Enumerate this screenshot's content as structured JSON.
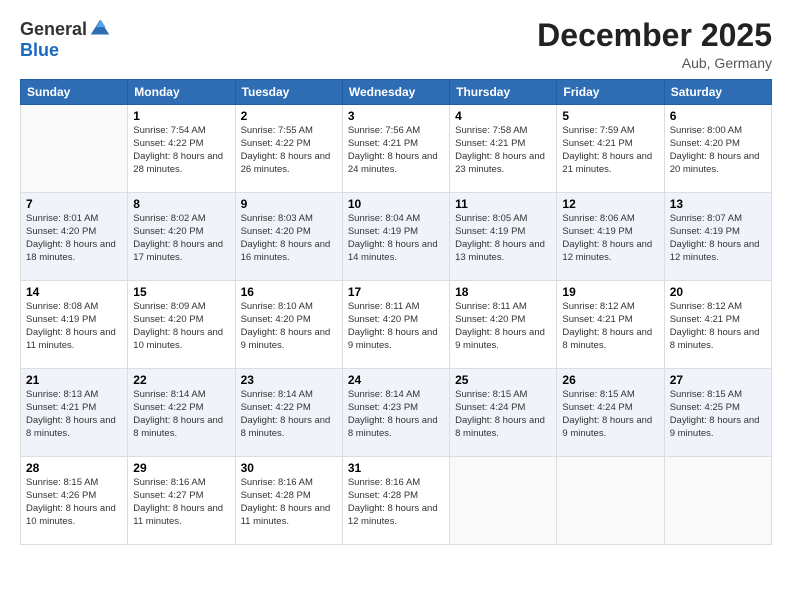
{
  "logo": {
    "general": "General",
    "blue": "Blue"
  },
  "header": {
    "month": "December 2025",
    "location": "Aub, Germany"
  },
  "days_of_week": [
    "Sunday",
    "Monday",
    "Tuesday",
    "Wednesday",
    "Thursday",
    "Friday",
    "Saturday"
  ],
  "weeks": [
    [
      {
        "day": "",
        "sunrise": "",
        "sunset": "",
        "daylight": ""
      },
      {
        "day": "1",
        "sunrise": "Sunrise: 7:54 AM",
        "sunset": "Sunset: 4:22 PM",
        "daylight": "Daylight: 8 hours and 28 minutes."
      },
      {
        "day": "2",
        "sunrise": "Sunrise: 7:55 AM",
        "sunset": "Sunset: 4:22 PM",
        "daylight": "Daylight: 8 hours and 26 minutes."
      },
      {
        "day": "3",
        "sunrise": "Sunrise: 7:56 AM",
        "sunset": "Sunset: 4:21 PM",
        "daylight": "Daylight: 8 hours and 24 minutes."
      },
      {
        "day": "4",
        "sunrise": "Sunrise: 7:58 AM",
        "sunset": "Sunset: 4:21 PM",
        "daylight": "Daylight: 8 hours and 23 minutes."
      },
      {
        "day": "5",
        "sunrise": "Sunrise: 7:59 AM",
        "sunset": "Sunset: 4:21 PM",
        "daylight": "Daylight: 8 hours and 21 minutes."
      },
      {
        "day": "6",
        "sunrise": "Sunrise: 8:00 AM",
        "sunset": "Sunset: 4:20 PM",
        "daylight": "Daylight: 8 hours and 20 minutes."
      }
    ],
    [
      {
        "day": "7",
        "sunrise": "Sunrise: 8:01 AM",
        "sunset": "Sunset: 4:20 PM",
        "daylight": "Daylight: 8 hours and 18 minutes."
      },
      {
        "day": "8",
        "sunrise": "Sunrise: 8:02 AM",
        "sunset": "Sunset: 4:20 PM",
        "daylight": "Daylight: 8 hours and 17 minutes."
      },
      {
        "day": "9",
        "sunrise": "Sunrise: 8:03 AM",
        "sunset": "Sunset: 4:20 PM",
        "daylight": "Daylight: 8 hours and 16 minutes."
      },
      {
        "day": "10",
        "sunrise": "Sunrise: 8:04 AM",
        "sunset": "Sunset: 4:19 PM",
        "daylight": "Daylight: 8 hours and 14 minutes."
      },
      {
        "day": "11",
        "sunrise": "Sunrise: 8:05 AM",
        "sunset": "Sunset: 4:19 PM",
        "daylight": "Daylight: 8 hours and 13 minutes."
      },
      {
        "day": "12",
        "sunrise": "Sunrise: 8:06 AM",
        "sunset": "Sunset: 4:19 PM",
        "daylight": "Daylight: 8 hours and 12 minutes."
      },
      {
        "day": "13",
        "sunrise": "Sunrise: 8:07 AM",
        "sunset": "Sunset: 4:19 PM",
        "daylight": "Daylight: 8 hours and 12 minutes."
      }
    ],
    [
      {
        "day": "14",
        "sunrise": "Sunrise: 8:08 AM",
        "sunset": "Sunset: 4:19 PM",
        "daylight": "Daylight: 8 hours and 11 minutes."
      },
      {
        "day": "15",
        "sunrise": "Sunrise: 8:09 AM",
        "sunset": "Sunset: 4:20 PM",
        "daylight": "Daylight: 8 hours and 10 minutes."
      },
      {
        "day": "16",
        "sunrise": "Sunrise: 8:10 AM",
        "sunset": "Sunset: 4:20 PM",
        "daylight": "Daylight: 8 hours and 9 minutes."
      },
      {
        "day": "17",
        "sunrise": "Sunrise: 8:11 AM",
        "sunset": "Sunset: 4:20 PM",
        "daylight": "Daylight: 8 hours and 9 minutes."
      },
      {
        "day": "18",
        "sunrise": "Sunrise: 8:11 AM",
        "sunset": "Sunset: 4:20 PM",
        "daylight": "Daylight: 8 hours and 9 minutes."
      },
      {
        "day": "19",
        "sunrise": "Sunrise: 8:12 AM",
        "sunset": "Sunset: 4:21 PM",
        "daylight": "Daylight: 8 hours and 8 minutes."
      },
      {
        "day": "20",
        "sunrise": "Sunrise: 8:12 AM",
        "sunset": "Sunset: 4:21 PM",
        "daylight": "Daylight: 8 hours and 8 minutes."
      }
    ],
    [
      {
        "day": "21",
        "sunrise": "Sunrise: 8:13 AM",
        "sunset": "Sunset: 4:21 PM",
        "daylight": "Daylight: 8 hours and 8 minutes."
      },
      {
        "day": "22",
        "sunrise": "Sunrise: 8:14 AM",
        "sunset": "Sunset: 4:22 PM",
        "daylight": "Daylight: 8 hours and 8 minutes."
      },
      {
        "day": "23",
        "sunrise": "Sunrise: 8:14 AM",
        "sunset": "Sunset: 4:22 PM",
        "daylight": "Daylight: 8 hours and 8 minutes."
      },
      {
        "day": "24",
        "sunrise": "Sunrise: 8:14 AM",
        "sunset": "Sunset: 4:23 PM",
        "daylight": "Daylight: 8 hours and 8 minutes."
      },
      {
        "day": "25",
        "sunrise": "Sunrise: 8:15 AM",
        "sunset": "Sunset: 4:24 PM",
        "daylight": "Daylight: 8 hours and 8 minutes."
      },
      {
        "day": "26",
        "sunrise": "Sunrise: 8:15 AM",
        "sunset": "Sunset: 4:24 PM",
        "daylight": "Daylight: 8 hours and 9 minutes."
      },
      {
        "day": "27",
        "sunrise": "Sunrise: 8:15 AM",
        "sunset": "Sunset: 4:25 PM",
        "daylight": "Daylight: 8 hours and 9 minutes."
      }
    ],
    [
      {
        "day": "28",
        "sunrise": "Sunrise: 8:15 AM",
        "sunset": "Sunset: 4:26 PM",
        "daylight": "Daylight: 8 hours and 10 minutes."
      },
      {
        "day": "29",
        "sunrise": "Sunrise: 8:16 AM",
        "sunset": "Sunset: 4:27 PM",
        "daylight": "Daylight: 8 hours and 11 minutes."
      },
      {
        "day": "30",
        "sunrise": "Sunrise: 8:16 AM",
        "sunset": "Sunset: 4:28 PM",
        "daylight": "Daylight: 8 hours and 11 minutes."
      },
      {
        "day": "31",
        "sunrise": "Sunrise: 8:16 AM",
        "sunset": "Sunset: 4:28 PM",
        "daylight": "Daylight: 8 hours and 12 minutes."
      },
      {
        "day": "",
        "sunrise": "",
        "sunset": "",
        "daylight": ""
      },
      {
        "day": "",
        "sunrise": "",
        "sunset": "",
        "daylight": ""
      },
      {
        "day": "",
        "sunrise": "",
        "sunset": "",
        "daylight": ""
      }
    ]
  ]
}
